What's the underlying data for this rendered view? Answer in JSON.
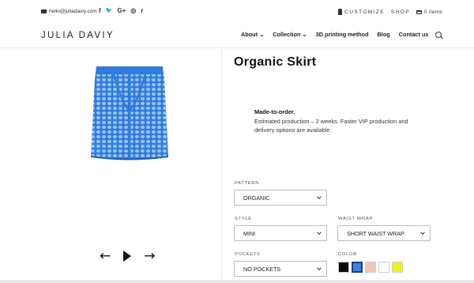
{
  "topbar": {
    "email": "hello@juliadaviy.com",
    "socials": [
      {
        "icon": "facebook-icon",
        "glyph": "f"
      },
      {
        "icon": "twitter-icon",
        "glyph": "🐦"
      },
      {
        "icon": "google-plus-icon",
        "glyph": "G+"
      },
      {
        "icon": "instagram-icon",
        "glyph": "◎"
      },
      {
        "icon": "rss-icon",
        "glyph": "ɾ"
      }
    ],
    "customize_label": "CUSTOMIZE",
    "shop_label": "SHOP",
    "cart_label": "0 items"
  },
  "header": {
    "logo": "JULIA DAVIY",
    "nav": [
      {
        "label": "About ⌄"
      },
      {
        "label": "Collection ⌄"
      },
      {
        "label": "3D printing method"
      },
      {
        "label": "Blog"
      },
      {
        "label": "Contact us"
      }
    ]
  },
  "product": {
    "title": "Organic Skirt",
    "info_heading": "Made-to-order.",
    "info_text": "Estimated production – 2 weeks. Faster VIP production and delivery options are available.",
    "pattern": {
      "label": "PATTERN",
      "value": "ORGANIC"
    },
    "style": {
      "label": "STYLE",
      "value": "MINI"
    },
    "waist_wrap": {
      "label": "WAIST WRAP",
      "value": "SHORT WAIST WRAP"
    },
    "pockets": {
      "label": "POCKETS",
      "value": "NO POCKETS"
    },
    "color": {
      "label": "COLOR",
      "swatches": [
        "#0a0a0a",
        "#3e83d6",
        "#f0c8b6",
        "#ffffff",
        "#f0f01c"
      ],
      "selected_index": 1
    }
  },
  "colors": {
    "skirt_blue": "#2f7bde",
    "skirt_pattern": "#a8cdf5"
  }
}
